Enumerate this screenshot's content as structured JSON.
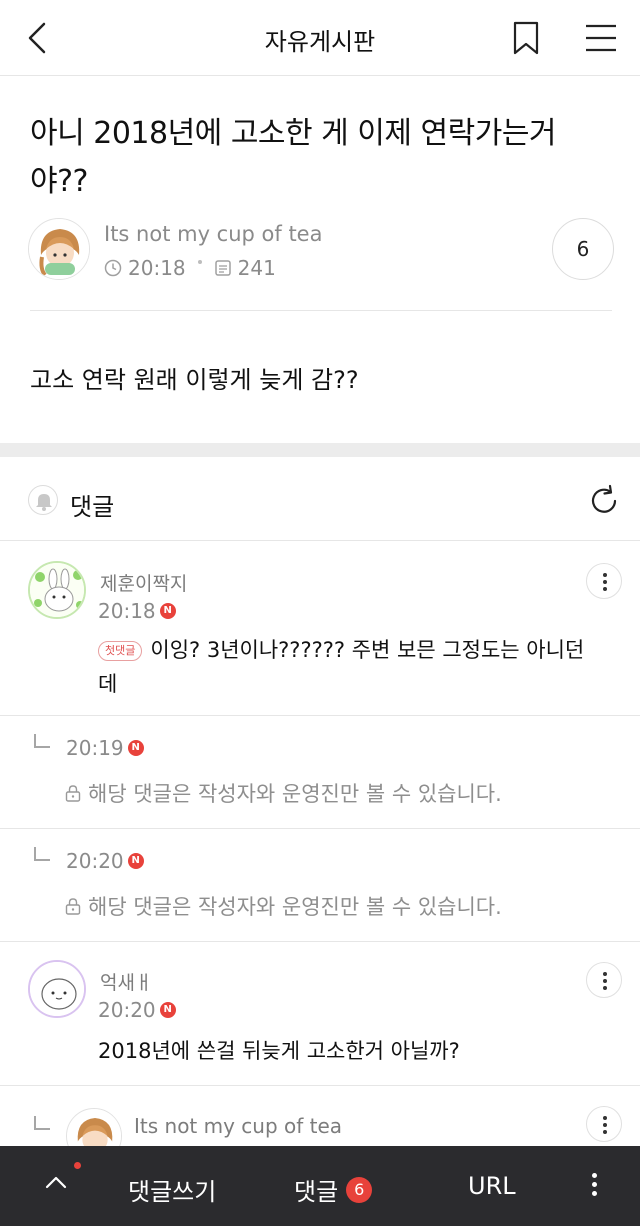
{
  "header": {
    "title": "자유게시판"
  },
  "post": {
    "title": "아니 2018년에 고소한 게 이제 연락가는거 야??",
    "author": "Its not my cup of tea",
    "time": "20:18",
    "views": "241",
    "comment_count": "6",
    "body": "고소 연락 원래 이렇게 늦게 감??"
  },
  "comments_section": {
    "label": "댓글"
  },
  "comments": [
    {
      "author": "제훈이짝지",
      "time": "20:18",
      "badge": "첫댓글",
      "text": "이잉? 3년이나?????? 주변 보믄 그정도는 아니던 데"
    },
    {
      "time": "20:19",
      "text": "해당 댓글은 작성자와 운영진만 볼 수 있습니다."
    },
    {
      "time": "20:20",
      "text": "해당 댓글은 작성자와 운영진만 볼 수 있습니다."
    },
    {
      "author": "억새ㅐ",
      "time": "20:20",
      "text": "2018년에 쓴걸 뒤늦게 고소한거 아닐까?"
    },
    {
      "author": "Its not my cup of tea"
    }
  ],
  "n_badge": "N",
  "bottom_bar": {
    "write_label": "댓글쓰기",
    "comments_label": "댓글",
    "comments_count": "6",
    "url_label": "URL"
  },
  "colors": {
    "accent_red": "#e8423b",
    "bottom_bar_bg": "#2b2b2e"
  }
}
